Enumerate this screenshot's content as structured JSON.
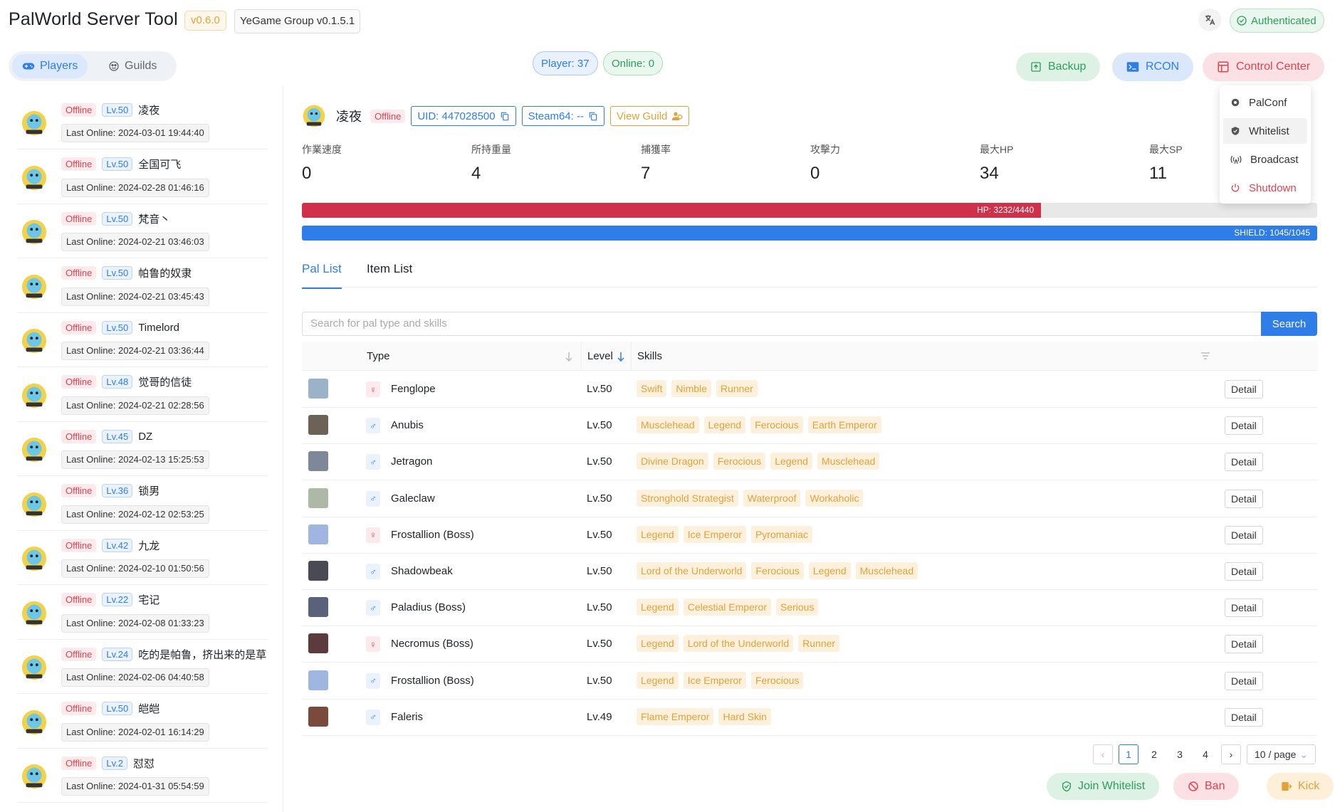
{
  "header": {
    "title": "PalWorld Server Tool",
    "version": "v0.6.0",
    "group": "YeGame Group v0.1.5.1",
    "auth": "Authenticated",
    "tabs": [
      {
        "label": "Players"
      },
      {
        "label": "Guilds"
      }
    ],
    "player_count": "Player: 37",
    "online_count": "Online: 0",
    "buttons": {
      "backup": "Backup",
      "rcon": "RCON",
      "control": "Control Center"
    }
  },
  "control_menu": [
    {
      "label": "PalConf",
      "icon": "gear-icon"
    },
    {
      "label": "Whitelist",
      "icon": "shield-icon"
    },
    {
      "label": "Broadcast",
      "icon": "broadcast-icon"
    },
    {
      "label": "Shutdown",
      "icon": "power-icon"
    }
  ],
  "players": [
    {
      "status": "Offline",
      "level": "Lv.50",
      "name": "凌夜",
      "last": "Last Online: 2024-03-01 19:44:40"
    },
    {
      "status": "Offline",
      "level": "Lv.50",
      "name": "全国可飞",
      "last": "Last Online: 2024-02-28 01:46:16"
    },
    {
      "status": "Offline",
      "level": "Lv.50",
      "name": "梵音丶",
      "last": "Last Online: 2024-02-21 03:46:03"
    },
    {
      "status": "Offline",
      "level": "Lv.50",
      "name": "帕鲁的奴隶",
      "last": "Last Online: 2024-02-21 03:45:43"
    },
    {
      "status": "Offline",
      "level": "Lv.50",
      "name": "Timelord",
      "last": "Last Online: 2024-02-21 03:36:44"
    },
    {
      "status": "Offline",
      "level": "Lv.48",
      "name": "觉哥的信徒",
      "last": "Last Online: 2024-02-21 02:28:56"
    },
    {
      "status": "Offline",
      "level": "Lv.45",
      "name": "DZ",
      "last": "Last Online: 2024-02-13 15:25:53"
    },
    {
      "status": "Offline",
      "level": "Lv.36",
      "name": "锁男",
      "last": "Last Online: 2024-02-12 02:53:25"
    },
    {
      "status": "Offline",
      "level": "Lv.42",
      "name": "九龙",
      "last": "Last Online: 2024-02-10 01:50:56"
    },
    {
      "status": "Offline",
      "level": "Lv.22",
      "name": "宅记",
      "last": "Last Online: 2024-02-08 01:33:23"
    },
    {
      "status": "Offline",
      "level": "Lv.24",
      "name": "吃的是帕鲁，挤出来的是草",
      "last": "Last Online: 2024-02-06 04:40:58"
    },
    {
      "status": "Offline",
      "level": "Lv.50",
      "name": "皑皑",
      "last": "Last Online: 2024-02-01 16:14:29"
    },
    {
      "status": "Offline",
      "level": "Lv.2",
      "name": "怼怼",
      "last": "Last Online: 2024-01-31 05:54:59"
    }
  ],
  "detail": {
    "name": "凌夜",
    "status": "Offline",
    "uid": "UID: 447028500",
    "steam": "Steam64: --",
    "view_guild": "View Guild",
    "stats": [
      {
        "label": "作業速度",
        "value": "0"
      },
      {
        "label": "所持重量",
        "value": "4"
      },
      {
        "label": "捕獲率",
        "value": "7"
      },
      {
        "label": "攻擊力",
        "value": "0"
      },
      {
        "label": "最大HP",
        "value": "34"
      },
      {
        "label": "最大SP",
        "value": "11"
      }
    ],
    "hp": {
      "text": "HP: 3232/4440",
      "fraction": 0.728,
      "color": "#d0304a"
    },
    "shield": {
      "text": "SHIELD: 1045/1045",
      "fraction": 1.0,
      "color": "#2e7de8"
    },
    "tabs": [
      {
        "label": "Pal List"
      },
      {
        "label": "Item List"
      }
    ],
    "search": {
      "placeholder": "Search for pal type and skills",
      "button": "Search"
    },
    "columns": {
      "type": "Type",
      "level": "Level",
      "skills": "Skills"
    },
    "detail_label": "Detail",
    "pals": [
      {
        "gender": "female",
        "type": "Fenglope",
        "level": "Lv.50",
        "skills": [
          "Swift",
          "Nimble",
          "Runner"
        ],
        "img": "#9bb3c9"
      },
      {
        "gender": "male",
        "type": "Anubis",
        "level": "Lv.50",
        "skills": [
          "Musclehead",
          "Legend",
          "Ferocious",
          "Earth Emperor"
        ],
        "img": "#6d6256"
      },
      {
        "gender": "male",
        "type": "Jetragon",
        "level": "Lv.50",
        "skills": [
          "Divine Dragon",
          "Ferocious",
          "Legend",
          "Musclehead"
        ],
        "img": "#7f8899"
      },
      {
        "gender": "male",
        "type": "Galeclaw",
        "level": "Lv.50",
        "skills": [
          "Stronghold Strategist",
          "Waterproof",
          "Workaholic"
        ],
        "img": "#aeb8a6"
      },
      {
        "gender": "female",
        "type": "Frostallion (Boss)",
        "level": "Lv.50",
        "skills": [
          "Legend",
          "Ice Emperor",
          "Pyromaniac"
        ],
        "img": "#9fb6e0"
      },
      {
        "gender": "male",
        "type": "Shadowbeak",
        "level": "Lv.50",
        "skills": [
          "Lord of the Underworld",
          "Ferocious",
          "Legend",
          "Musclehead"
        ],
        "img": "#4a4a55"
      },
      {
        "gender": "male",
        "type": "Paladius (Boss)",
        "level": "Lv.50",
        "skills": [
          "Legend",
          "Celestial Emperor",
          "Serious"
        ],
        "img": "#59627a"
      },
      {
        "gender": "female",
        "type": "Necromus (Boss)",
        "level": "Lv.50",
        "skills": [
          "Legend",
          "Lord of the Underworld",
          "Runner"
        ],
        "img": "#5d3a3e"
      },
      {
        "gender": "male",
        "type": "Frostallion (Boss)",
        "level": "Lv.50",
        "skills": [
          "Legend",
          "Ice Emperor",
          "Ferocious"
        ],
        "img": "#9fb6e0"
      },
      {
        "gender": "male",
        "type": "Faleris",
        "level": "Lv.49",
        "skills": [
          "Flame Emperor",
          "Hard Skin"
        ],
        "img": "#7a4b3a"
      }
    ],
    "pagination": {
      "pages": [
        "1",
        "2",
        "3",
        "4"
      ],
      "current": "1",
      "page_size": "10 / page"
    },
    "actions": {
      "whitelist": "Join Whitelist",
      "ban": "Ban",
      "kick": "Kick"
    }
  }
}
